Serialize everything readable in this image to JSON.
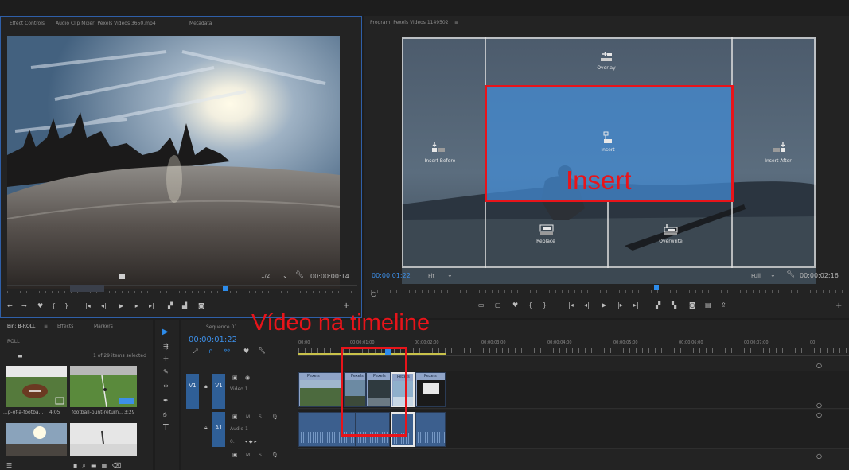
{
  "source": {
    "tabs": [
      "Effect Controls",
      "Audio Clip Mixer: Pexels Videos 3650.mp4",
      "Metadata"
    ],
    "fraction": "1/2",
    "timecode": "00:00:00:14"
  },
  "program": {
    "title": "Program: Pexels Videos 1149502",
    "menu": "≡",
    "timecode_left": "00:00:01:22",
    "fit": "Fit",
    "quality": "Full",
    "timecode_right": "00:00:02:16",
    "overlay": {
      "overlay": "Overlay",
      "insert": "Insert",
      "insert_before": "Insert Before",
      "insert_after": "Insert After",
      "replace": "Replace",
      "overwrite": "Overwrite"
    },
    "annotation_insert": "Insert"
  },
  "project": {
    "tabs": [
      "Bin: B-ROLL",
      "Effects",
      "Markers"
    ],
    "menu": "≡",
    "path": "ROLL",
    "count": "1 of 29 items selected",
    "items": [
      {
        "name": "...p-of-a-footba...",
        "duration": "4:05"
      },
      {
        "name": "football-punt-return...",
        "duration": "3:29"
      }
    ]
  },
  "timeline": {
    "tab": "Sequence 01",
    "timecode": "00:00:01:22",
    "annotation": "Vídeo na timeline",
    "ruler": [
      "00:00",
      "00:00:01:00",
      "00:00:02:00",
      "00:00:03:00",
      "00:00:04:00",
      "00:00:05:00",
      "00:00:06:00",
      "00:00:07:00",
      "00"
    ],
    "tracks": [
      {
        "name": "Video 1",
        "label": "V1",
        "target": "V1"
      },
      {
        "name": "Audio 1",
        "label": "A1",
        "target": "A1"
      }
    ],
    "track_buttons": [
      "M",
      "S"
    ],
    "clip_label": "Pexels",
    "audio_level": "0."
  },
  "colors": {
    "accent": "#2d8ceb",
    "annotation": "#e8141a",
    "panel": "#232323",
    "clip_video": "#8fa4c8",
    "clip_audio": "#3c5f8e"
  }
}
